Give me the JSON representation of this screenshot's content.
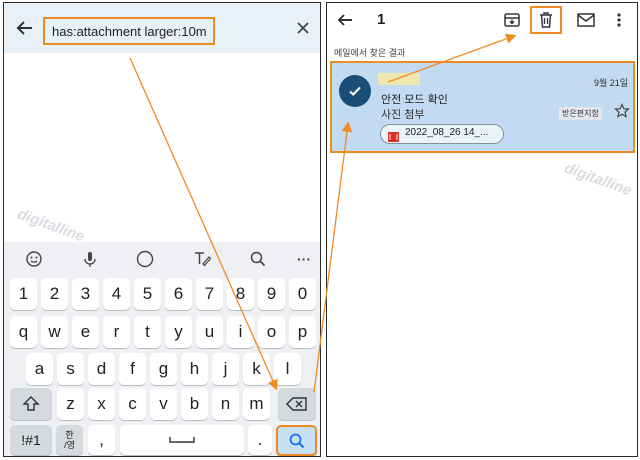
{
  "left": {
    "search_query": "has:attachment larger:10m",
    "watermark": "digitalline",
    "keyboard": {
      "row_numbers": [
        "1",
        "2",
        "3",
        "4",
        "5",
        "6",
        "7",
        "8",
        "9",
        "0"
      ],
      "row1": [
        "q",
        "w",
        "e",
        "r",
        "t",
        "y",
        "u",
        "i",
        "o",
        "p"
      ],
      "row2": [
        "a",
        "s",
        "d",
        "f",
        "g",
        "h",
        "j",
        "k",
        "l"
      ],
      "row3": [
        "z",
        "x",
        "c",
        "v",
        "b",
        "n",
        "m"
      ],
      "symbols_key": "!#1",
      "lang_key_top": "한",
      "lang_key_bottom": "/영",
      "comma_key": ",",
      "period_key": ".",
      "toolbar_more": "···"
    }
  },
  "right": {
    "selected_count": "1",
    "section_label": "메일에서 찾은 결과",
    "email": {
      "date": "9월 21일",
      "subject": "안전 모드 확인",
      "preview": "사진 첨부",
      "label": "받은편지함",
      "attachment_name": "2022_08_26 14_..."
    },
    "watermark": "digitalline"
  },
  "colors": {
    "accent": "#f08a24",
    "selected_bg": "#c2dbf2",
    "check_circle": "#1a4e79",
    "search_bar": "#e8f0f8"
  }
}
